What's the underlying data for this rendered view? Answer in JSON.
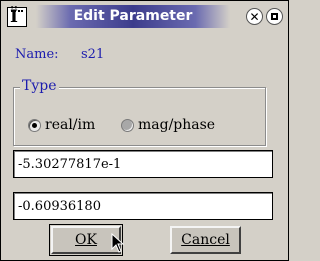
{
  "window": {
    "title": "Edit Parameter",
    "app_icon_glyph": "Ï"
  },
  "name_row": {
    "label": "Name:",
    "value": "s21"
  },
  "type_group": {
    "label": "Type",
    "options": [
      {
        "label": "real/im",
        "checked": true
      },
      {
        "label": "mag/phase",
        "checked": false
      }
    ]
  },
  "fields": {
    "first_value": "-5.30277817e-1",
    "second_value": "-0.60936180"
  },
  "buttons": {
    "ok_label": "OK",
    "cancel_label": "Cancel"
  },
  "colors": {
    "label_blue": "#1c1cae",
    "title_bar": "#3c3c8c",
    "dialog_bg": "#d4d0c8"
  }
}
